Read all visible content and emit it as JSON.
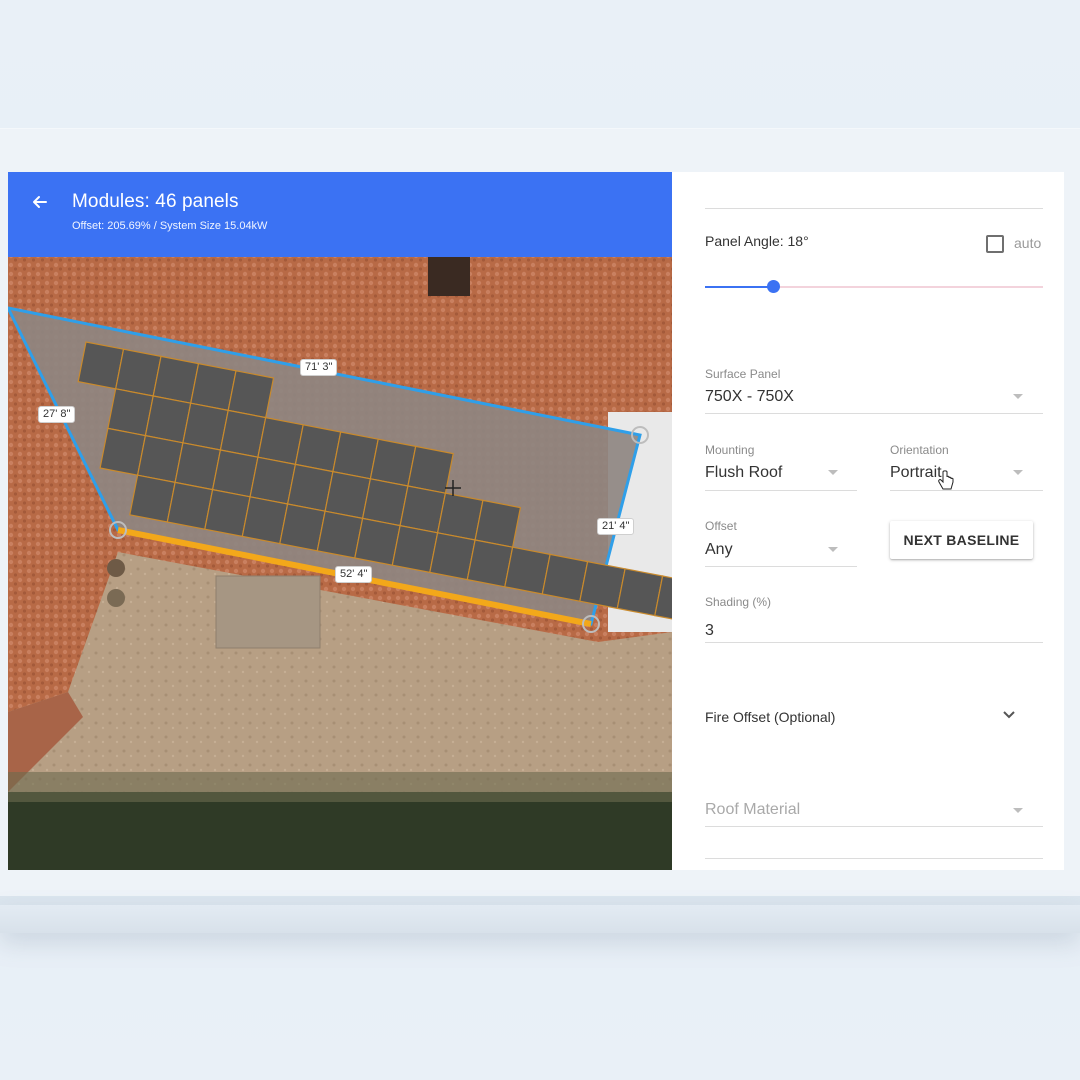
{
  "header": {
    "title": "Modules: 46 panels",
    "subtitle": "Offset: 205.69% / System Size 15.04kW"
  },
  "map": {
    "dimensions": {
      "top_edge": "71' 3\"",
      "left_edge": "27' 8\"",
      "right_edge": "21' 4\"",
      "bottom_edge": "52' 4\""
    },
    "panel_rows": [
      5,
      9,
      11,
      16
    ],
    "colors": {
      "outline": "#2f9fe9",
      "baseline": "#f3a81a",
      "panel_fill": "#565656",
      "panel_grid": "#c98a2c",
      "roof": "#b86a46"
    }
  },
  "settings": {
    "panel_angle_label": "Panel Angle: 18°",
    "panel_angle_degrees": 18,
    "auto_label": "auto",
    "surface_panel": {
      "label": "Surface Panel",
      "value": "750X - 750X"
    },
    "mounting": {
      "label": "Mounting",
      "value": "Flush Roof"
    },
    "orientation": {
      "label": "Orientation",
      "value": "Portrait"
    },
    "offset": {
      "label": "Offset",
      "value": "Any"
    },
    "next_baseline_label": "NEXT BASELINE",
    "shading": {
      "label": "Shading (%)",
      "value": "3"
    },
    "fire_offset_label": "Fire Offset (Optional)",
    "roof_material_placeholder": "Roof Material"
  }
}
